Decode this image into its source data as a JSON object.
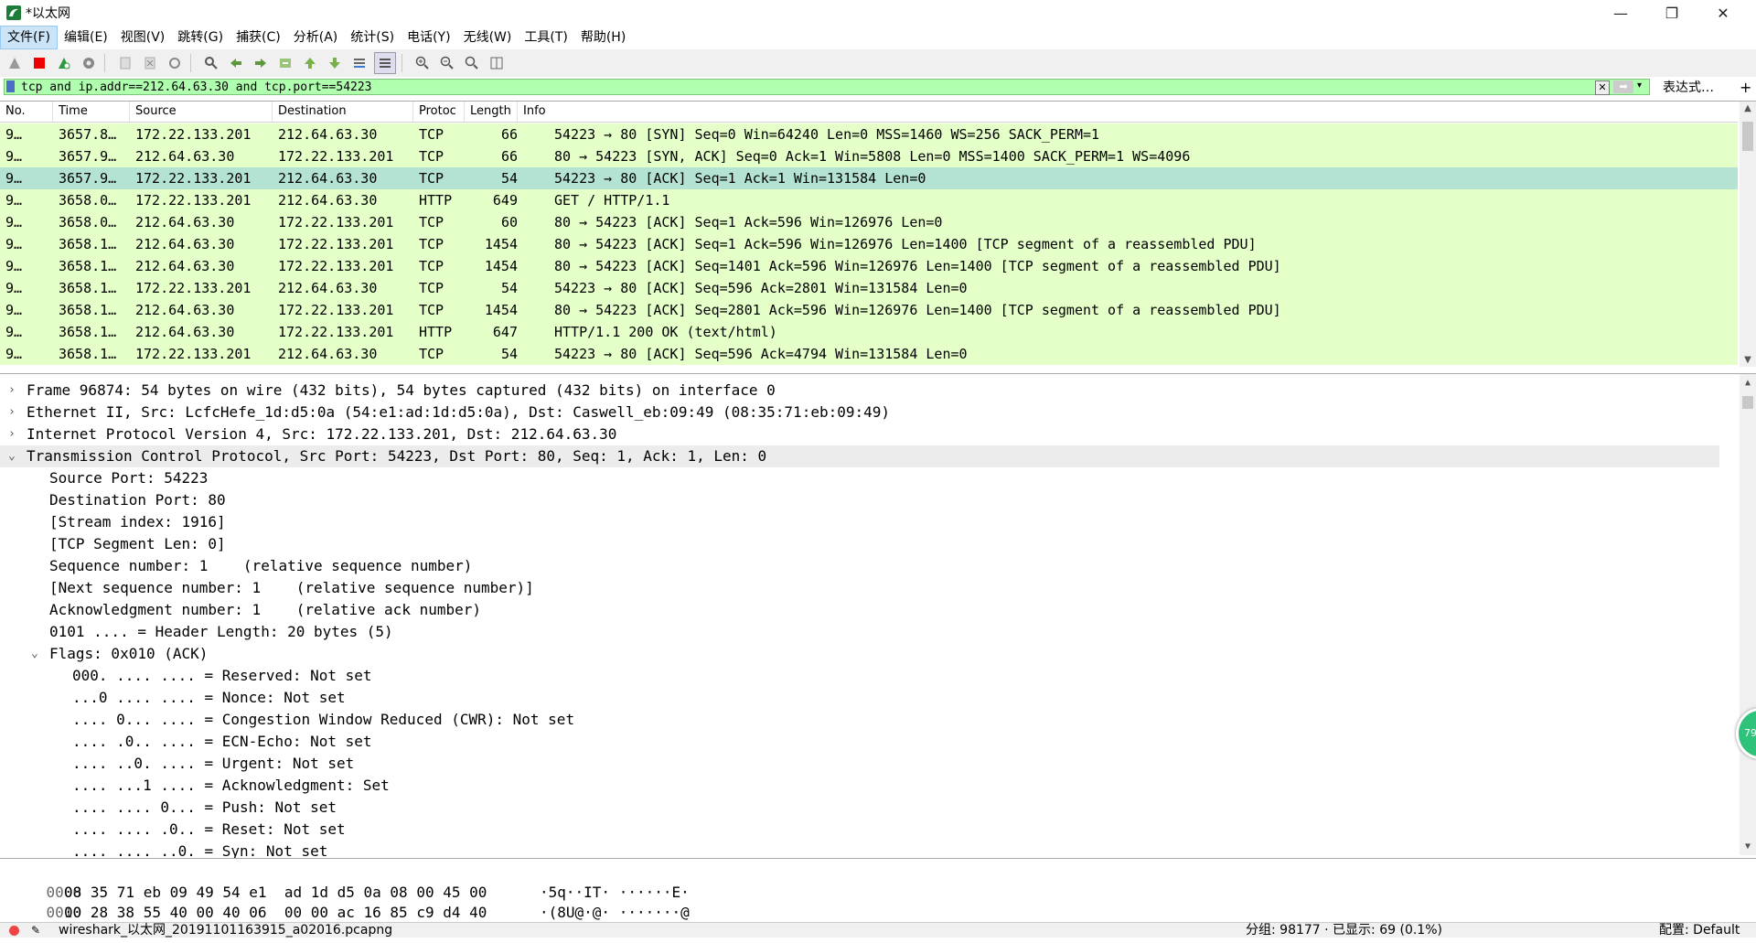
{
  "window": {
    "title": "*以太网"
  },
  "menu": [
    "文件(F)",
    "编辑(E)",
    "视图(V)",
    "跳转(G)",
    "捕获(C)",
    "分析(A)",
    "统计(S)",
    "电话(Y)",
    "无线(W)",
    "工具(T)",
    "帮助(H)"
  ],
  "toolbar": {
    "icons": [
      "shark-fin-start-icon",
      "stop-capture-icon",
      "restart-capture-icon",
      "capture-options-icon",
      "open-file-icon",
      "close-file-icon",
      "reload-icon",
      "find-icon",
      "back-icon",
      "forward-icon",
      "go-to-packet-icon",
      "first-packet-icon",
      "last-packet-icon",
      "auto-scroll-icon",
      "colorize-icon",
      "zoom-in-icon",
      "zoom-out-icon",
      "normal-size-icon",
      "resize-columns-icon"
    ]
  },
  "filter": {
    "value": "tcp and ip.addr==212.64.63.30 and tcp.port==54223",
    "expression_label": "表达式…",
    "add_label": "+"
  },
  "packet_list": {
    "columns": [
      "No.",
      "Time",
      "Source",
      "Destination",
      "Protoc",
      "Length",
      "Info"
    ],
    "rows": [
      {
        "no": "9…",
        "time": "3657.8…",
        "src": "172.22.133.201",
        "dst": "212.64.63.30",
        "proto": "TCP",
        "len": "66",
        "info": "54223 → 80 [SYN] Seq=0 Win=64240 Len=0 MSS=1460 WS=256 SACK_PERM=1"
      },
      {
        "no": "9…",
        "time": "3657.9…",
        "src": "212.64.63.30",
        "dst": "172.22.133.201",
        "proto": "TCP",
        "len": "66",
        "info": "80 → 54223 [SYN, ACK] Seq=0 Ack=1 Win=5808 Len=0 MSS=1400 SACK_PERM=1 WS=4096"
      },
      {
        "no": "9…",
        "time": "3657.9…",
        "src": "172.22.133.201",
        "dst": "212.64.63.30",
        "proto": "TCP",
        "len": "54",
        "info": "54223 → 80 [ACK] Seq=1 Ack=1 Win=131584 Len=0"
      },
      {
        "no": "9…",
        "time": "3658.0…",
        "src": "172.22.133.201",
        "dst": "212.64.63.30",
        "proto": "HTTP",
        "len": "649",
        "info": "GET / HTTP/1.1"
      },
      {
        "no": "9…",
        "time": "3658.0…",
        "src": "212.64.63.30",
        "dst": "172.22.133.201",
        "proto": "TCP",
        "len": "60",
        "info": "80 → 54223 [ACK] Seq=1 Ack=596 Win=126976 Len=0"
      },
      {
        "no": "9…",
        "time": "3658.1…",
        "src": "212.64.63.30",
        "dst": "172.22.133.201",
        "proto": "TCP",
        "len": "1454",
        "info": "80 → 54223 [ACK] Seq=1 Ack=596 Win=126976 Len=1400 [TCP segment of a reassembled PDU]"
      },
      {
        "no": "9…",
        "time": "3658.1…",
        "src": "212.64.63.30",
        "dst": "172.22.133.201",
        "proto": "TCP",
        "len": "1454",
        "info": "80 → 54223 [ACK] Seq=1401 Ack=596 Win=126976 Len=1400 [TCP segment of a reassembled PDU]"
      },
      {
        "no": "9…",
        "time": "3658.1…",
        "src": "172.22.133.201",
        "dst": "212.64.63.30",
        "proto": "TCP",
        "len": "54",
        "info": "54223 → 80 [ACK] Seq=596 Ack=2801 Win=131584 Len=0"
      },
      {
        "no": "9…",
        "time": "3658.1…",
        "src": "212.64.63.30",
        "dst": "172.22.133.201",
        "proto": "TCP",
        "len": "1454",
        "info": "80 → 54223 [ACK] Seq=2801 Ack=596 Win=126976 Len=1400 [TCP segment of a reassembled PDU]"
      },
      {
        "no": "9…",
        "time": "3658.1…",
        "src": "212.64.63.30",
        "dst": "172.22.133.201",
        "proto": "HTTP",
        "len": "647",
        "info": "HTTP/1.1 200 OK  (text/html)"
      },
      {
        "no": "9…",
        "time": "3658.1…",
        "src": "172.22.133.201",
        "dst": "212.64.63.30",
        "proto": "TCP",
        "len": "54",
        "info": "54223 → 80 [ACK] Seq=596 Ack=4794 Win=131584 Len=0"
      }
    ]
  },
  "details": [
    "Frame 96874: 54 bytes on wire (432 bits), 54 bytes captured (432 bits) on interface 0",
    "Ethernet II, Src: LcfcHefe_1d:d5:0a (54:e1:ad:1d:d5:0a), Dst: Caswell_eb:09:49 (08:35:71:eb:09:49)",
    "Internet Protocol Version 4, Src: 172.22.133.201, Dst: 212.64.63.30",
    "Transmission Control Protocol, Src Port: 54223, Dst Port: 80, Seq: 1, Ack: 1, Len: 0",
    "Source Port: 54223",
    "Destination Port: 80",
    "[Stream index: 1916]",
    "[TCP Segment Len: 0]",
    "Sequence number: 1    (relative sequence number)",
    "[Next sequence number: 1    (relative sequence number)]",
    "Acknowledgment number: 1    (relative ack number)",
    "0101 .... = Header Length: 20 bytes (5)",
    "Flags: 0x010 (ACK)",
    "000. .... .... = Reserved: Not set",
    "...0 .... .... = Nonce: Not set",
    ".... 0... .... = Congestion Window Reduced (CWR): Not set",
    ".... .0.. .... = ECN-Echo: Not set",
    ".... ..0. .... = Urgent: Not set",
    ".... ...1 .... = Acknowledgment: Set",
    ".... .... 0... = Push: Not set",
    ".... .... .0.. = Reset: Not set",
    ".... .... ..0. = Syn: Not set"
  ],
  "bytes": [
    {
      "offset": "0000",
      "hex": "08 35 71 eb 09 49 54 e1  ad 1d d5 0a 08 00 45 00",
      "ascii": "·5q··IT· ······E·"
    },
    {
      "offset": "0010",
      "hex": "00 28 38 55 40 00 40 06  00 00 ac 16 85 c9 d4 40",
      "ascii": "·(8U@·@· ·······@"
    }
  ],
  "status": {
    "file": "wireshark_以太网_20191101163915_a02016.pcapng",
    "packets": "分组: 98177 · 已显示: 69 (0.1%)",
    "profile": "配置: Default"
  },
  "float_badge": "79",
  "colors": {
    "tcp_row": "#e4ffc7",
    "selected_row": "#b4e2d3",
    "filter_bg": "#afffaf"
  }
}
